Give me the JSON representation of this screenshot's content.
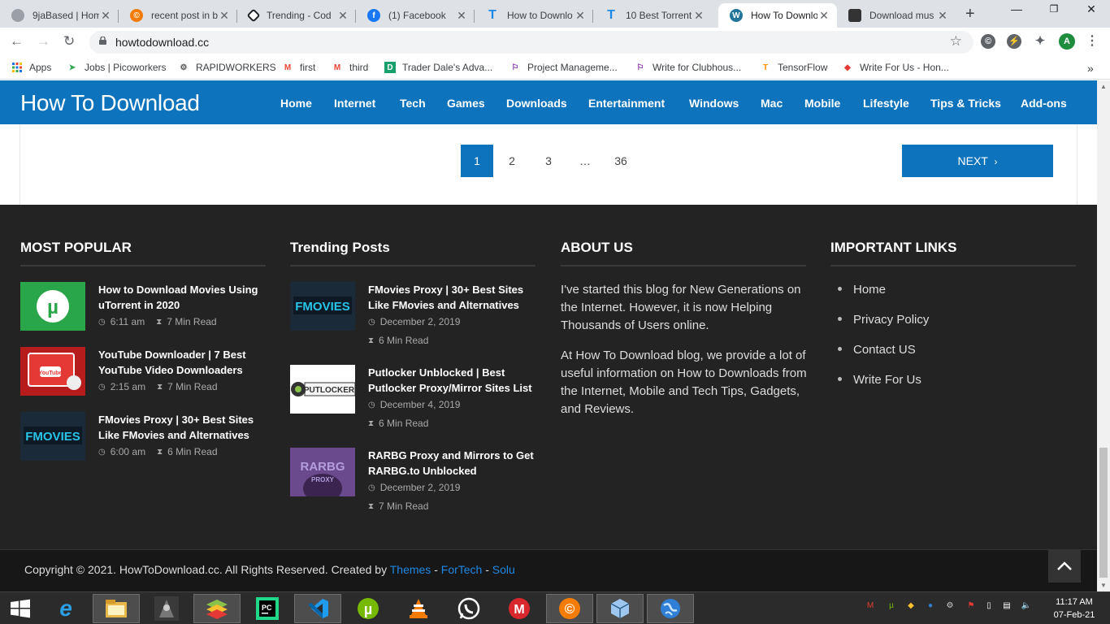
{
  "browser": {
    "tabs": [
      {
        "title": "9jaBased | Hom",
        "favicon": "grey-circle-icon",
        "fav_color": "#9aa0a6",
        "active": false
      },
      {
        "title": "recent post in b",
        "favicon": "copyright-icon",
        "fav_color": "#f57c00",
        "active": false
      },
      {
        "title": "Trending - Cod",
        "favicon": "codepen-icon",
        "fav_color": "#202124",
        "active": false
      },
      {
        "title": "(1) Facebook",
        "favicon": "facebook-icon",
        "fav_color": "#1877f2",
        "active": false
      },
      {
        "title": "How to Downlo",
        "favicon": "t-blue-icon",
        "fav_color": "#1e88e5",
        "active": false
      },
      {
        "title": "10 Best Torrent",
        "favicon": "t-blue-icon",
        "fav_color": "#1e88e5",
        "active": false
      },
      {
        "title": "How To Downlo",
        "favicon": "wordpress-icon",
        "fav_color": "#21759b",
        "active": true
      },
      {
        "title": "Download mus",
        "favicon": "music-site-icon",
        "fav_color": "#333333",
        "active": false
      }
    ],
    "new_tab": "+",
    "url": "howtodownload.cc",
    "profile_initial": "A",
    "bookmarks": [
      {
        "label": "Apps",
        "icon": "apps-grid-icon"
      },
      {
        "label": "Jobs | Picoworkers",
        "icon": "picoworkers-icon"
      },
      {
        "label": "RAPIDWORKERS",
        "icon": "rapidworkers-icon"
      },
      {
        "label": "first",
        "icon": "gmail-icon"
      },
      {
        "label": "third",
        "icon": "gmail-icon"
      },
      {
        "label": "Trader Dale's Adva...",
        "icon": "trader-dale-icon"
      },
      {
        "label": "Project Manageme...",
        "icon": "clubhouse-flag-icon"
      },
      {
        "label": "Write for Clubhous...",
        "icon": "clubhouse-flag-icon"
      },
      {
        "label": "TensorFlow",
        "icon": "tensorflow-icon"
      },
      {
        "label": "Write For Us - Hon...",
        "icon": "write-for-us-icon"
      }
    ],
    "bookmarks_more": "»"
  },
  "site": {
    "logo": "How To Download",
    "menu": [
      "Home",
      "Internet",
      "Tech",
      "Games",
      "Downloads",
      "Entertainment",
      "Windows",
      "Mac",
      "Mobile",
      "Lifestyle",
      "Tips & Tricks",
      "Add-ons"
    ],
    "pagination": {
      "pages": [
        "1",
        "2",
        "3",
        "…",
        "36"
      ],
      "current": "1",
      "next": "NEXT"
    },
    "footer": {
      "most_popular": {
        "heading": "MOST POPULAR",
        "posts": [
          {
            "title": "How to Download Movies Using uTorrent in 2020",
            "time": "6:11 am",
            "read": "7 Min Read",
            "thumb": "utorrent"
          },
          {
            "title": "YouTube Downloader | 7 Best YouTube Video Downloaders",
            "time": "2:15 am",
            "read": "7 Min Read",
            "thumb": "youtube"
          },
          {
            "title": "FMovies Proxy | 30+ Best Sites Like FMovies and Alternatives",
            "time": "6:00 am",
            "read": "6 Min Read",
            "thumb": "fmovies"
          }
        ]
      },
      "trending": {
        "heading": "Trending Posts",
        "posts": [
          {
            "title": "FMovies Proxy | 30+ Best Sites Like FMovies and Alternatives",
            "date": "December 2, 2019",
            "read": "6 Min Read",
            "thumb": "fmovies"
          },
          {
            "title": "Putlocker Unblocked | Best Putlocker Proxy/Mirror Sites List",
            "date": "December 4, 2019",
            "read": "6 Min Read",
            "thumb": "putlocker"
          },
          {
            "title": "RARBG Proxy and Mirrors to Get RARBG.to Unblocked",
            "date": "December 2, 2019",
            "read": "7 Min Read",
            "thumb": "rarbg"
          }
        ]
      },
      "about": {
        "heading": "ABOUT US",
        "p1": "I've started this blog for New Generations on the Internet. However, it is now Helping Thousands of Users online.",
        "p2": "At How To Download blog, we provide a lot of useful information on How to Downloads from the Internet, Mobile and Tech Tips, Gadgets, and Reviews."
      },
      "links": {
        "heading": "IMPORTANT LINKS",
        "items": [
          "Home",
          "Privacy Policy",
          "Contact US",
          "Write For Us"
        ]
      },
      "copyright": {
        "prefix": "Copyright © 2021. HowToDownload.cc. All Rights Reserved. Created by ",
        "link1": "Themes",
        "sep1": " - ",
        "link2": "ForTech",
        "sep2": " - ",
        "link3": "Solu"
      },
      "thumb_labels": {
        "fmovies": "FMOVIES",
        "putlocker": "PUTLOCKER",
        "rarbg": "RARBG",
        "rarbg_sub": "PROXY",
        "youtube": "YouTube"
      }
    }
  },
  "taskbar": {
    "apps": [
      "start-icon",
      "internet-explorer-icon",
      "file-explorer-icon",
      "game-icon",
      "bluestacks-icon",
      "pycharm-icon",
      "vscode-icon",
      "utorrent-icon",
      "vlc-icon",
      "whatsapp-icon",
      "mega-icon",
      "copyright-app-icon",
      "virtualbox-icon",
      "globe-network-icon"
    ],
    "clock_time": "11:17 AM",
    "clock_date": "07-Feb-21"
  },
  "colors": {
    "brand": "#0d73bc",
    "footer_bg": "#232323",
    "link": "#1e88e5"
  }
}
